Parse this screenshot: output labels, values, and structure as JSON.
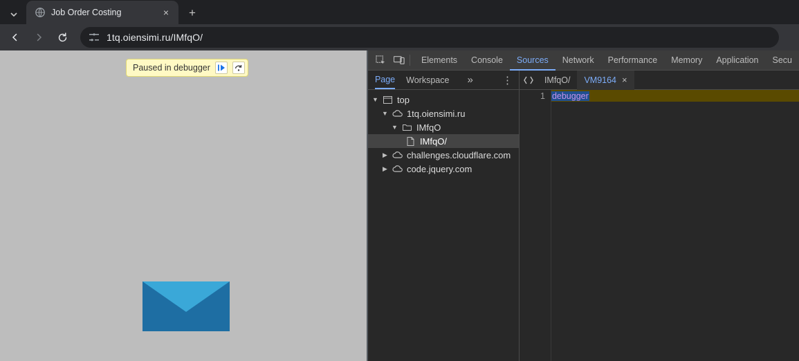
{
  "browser": {
    "tab_title": "Job Order Costing",
    "url": "1tq.oiensimi.ru/IMfqO/"
  },
  "paused_label": "Paused in debugger",
  "devtools": {
    "panels": [
      "Elements",
      "Console",
      "Sources",
      "Network",
      "Performance",
      "Memory",
      "Application",
      "Secu"
    ],
    "active_panel": "Sources",
    "navigator_tabs": [
      "Page",
      "Workspace"
    ],
    "navigator_active": "Page",
    "tree": {
      "top": "top",
      "origin": "1tq.oiensimi.ru",
      "folder": "IMfqO",
      "file": "IMfqO/",
      "other_origins": [
        "challenges.cloudflare.com",
        "code.jquery.com"
      ]
    },
    "open_files": [
      {
        "name": "IMfqO/",
        "active": false
      },
      {
        "name": "VM9164",
        "active": true
      }
    ],
    "code": {
      "line_number": "1",
      "text": "debugger"
    }
  }
}
